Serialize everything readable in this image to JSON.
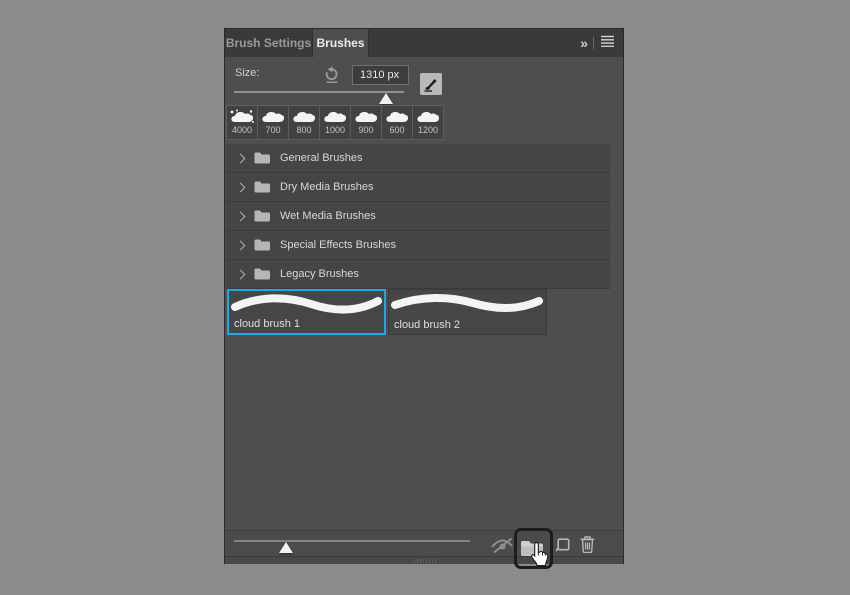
{
  "tabs": {
    "settings": "Brush Settings",
    "brushes": "Brushes"
  },
  "header": {
    "collapse_glyph": "»"
  },
  "size_control": {
    "label": "Size:",
    "value": "1310 px"
  },
  "presets": {
    "labels": [
      "4000",
      "700",
      "800",
      "1000",
      "900",
      "600",
      "1200"
    ]
  },
  "folders": {
    "items": [
      "General Brushes",
      "Dry Media Brushes",
      "Wet Media Brushes",
      "Special Effects Brushes",
      "Legacy Brushes"
    ]
  },
  "brushes": {
    "items": [
      {
        "name": "cloud brush 1",
        "selected": true
      },
      {
        "name": "cloud brush 2",
        "selected": false
      }
    ]
  },
  "colors": {
    "selection_border": "#1ca8e8",
    "panel_bg": "#4e4e4e",
    "tabbar_bg": "#3a3a3a",
    "row_bg": "#454545"
  }
}
